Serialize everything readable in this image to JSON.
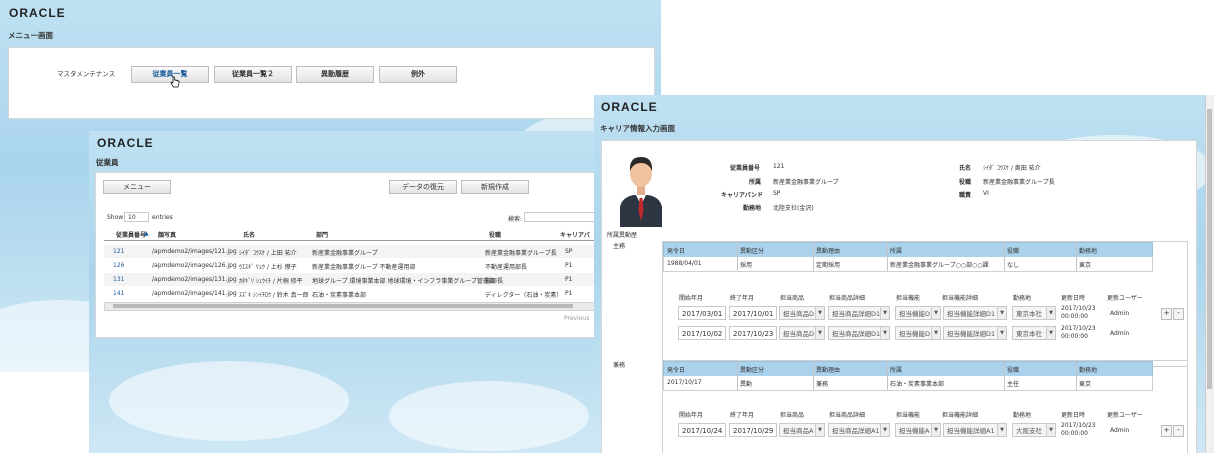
{
  "menu": {
    "logo": "ORACLE",
    "title": "メニュー画面",
    "section_label": "マスタメンテナンス",
    "buttons": [
      "従業員一覧",
      "従業員一覧２",
      "異動履歴",
      "例外"
    ]
  },
  "employee": {
    "logo": "ORACLE",
    "title": "従業員",
    "menu_button": "メニュー",
    "restore_button": "データの復元",
    "new_button": "新規作成",
    "show_label": "Show",
    "show_value": "10",
    "entries_label": "entries",
    "search_label": "検索:",
    "columns": [
      "従業員番号",
      "顔写真",
      "氏名",
      "部門",
      "役職",
      "キャリアバ"
    ],
    "rows": [
      [
        "121",
        "/apmdemo2/images/121.jpg",
        "ｼｲﾀﾞ ｺｳｽｹ / 上田 祐介",
        "新産業金融事業グループ",
        "新産業金融事業グループ長",
        "SP"
      ],
      [
        "126",
        "/apmdemo2/images/126.jpg",
        "ｳｴｽｷﾞ ﾘｮｳ / 上杉 僚子",
        "新産業金融事業グループ 不動産運用部",
        "不動産運用部長",
        "P1"
      ],
      [
        "131",
        "/apmdemo2/images/131.jpg",
        "ｶﾀｷﾞﾘ ｼｭｳｲﾁ / 片桐 修平",
        "地球グループ 環境事業本部 地球環境・インフラ事業グループ管理部",
        "副部長",
        "P1"
      ],
      [
        "141",
        "/apmdemo2/images/141.jpg",
        "ｽｽﾞｷ ｼﾝｲﾁﾛｳ / 鈴木 真一郎",
        "石油・炭素事業本部",
        "ディレクター（石油・炭素）",
        "P1"
      ]
    ],
    "previous": "Previous"
  },
  "career": {
    "logo": "ORACLE",
    "title": "キャリア情報入力画面",
    "info": {
      "emp_no_label": "従業員番号",
      "emp_no": "121",
      "dept_label": "所属",
      "dept": "新産業金融事業グループ",
      "band_label": "キャリアバンド",
      "band": "SP",
      "loc_label": "勤務地",
      "loc": "北陸支社(金沢)",
      "name_label": "氏名",
      "name": "ｼｲﾀﾞ ｺｳｽｹ / 奥田 祐介",
      "title_label": "役職",
      "title": "新産業金融事業グループ長",
      "grade_label": "職責",
      "grade": "VI"
    },
    "history_label": "所属異動歴",
    "main_label": "主務",
    "sub_label": "兼務",
    "table_headers": [
      "発令日",
      "異動区分",
      "異動理由",
      "所属",
      "役職",
      "勤務地"
    ],
    "main_row": [
      "1988/04/01",
      "採用",
      "定期採用",
      "新産業金融事業グループ○○部○○課",
      "なし",
      "東京"
    ],
    "sub_row": [
      "2017/10/17",
      "異動",
      "兼務",
      "石油・炭素事業本部",
      "主任",
      "東京"
    ],
    "sub_headers": [
      "開始年月",
      "終了年月",
      "担当商品",
      "担当商品詳細",
      "担当機能",
      "担当機能詳細",
      "勤務地",
      "更新日時",
      "更新ユーザー"
    ],
    "main_details": [
      [
        "2017/03/01",
        "2017/10/01",
        "担当商品D",
        "担当商品詳細D1",
        "担当機能D",
        "担当機能詳細D1",
        "東京本社",
        "2017/10/23",
        "00:00:00",
        "Admin"
      ],
      [
        "2017/10/02",
        "2017/10/23",
        "担当商品D",
        "担当商品詳細D1",
        "担当機能D",
        "担当機能詳細D1",
        "東京本社",
        "2017/10/23",
        "00:00:00",
        "Admin"
      ]
    ],
    "sub_details": [
      [
        "2017/10/24",
        "2017/10/29",
        "担当商品A",
        "担当商品詳細A1",
        "担当機能A",
        "担当機能詳細A1",
        "大阪支社",
        "2017/10/23",
        "00:00:00",
        "Admin"
      ]
    ],
    "plus": "+",
    "minus": "-"
  }
}
